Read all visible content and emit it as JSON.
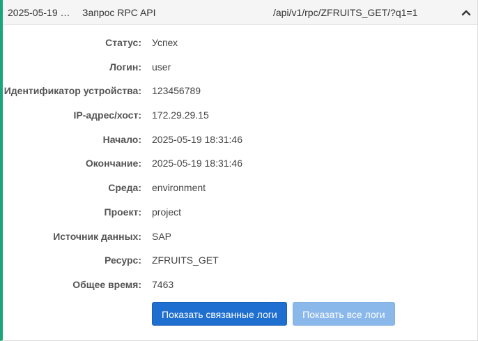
{
  "header": {
    "time": "2025-05-19 1...",
    "type": "Запрос RPC API",
    "url": "/api/v1/rpc/ZFRUITS_GET/?q1=1",
    "toggle_icon": "chevron-up-icon"
  },
  "details": [
    {
      "label": "Статус:",
      "value": "Успех"
    },
    {
      "label": "Логин:",
      "value": "user"
    },
    {
      "label": "Идентификатор устройства:",
      "value": "123456789"
    },
    {
      "label": "IP-адрес/хост:",
      "value": "172.29.29.15"
    },
    {
      "label": "Начало:",
      "value": "2025-05-19 18:31:46"
    },
    {
      "label": "Окончание:",
      "value": "2025-05-19 18:31:46"
    },
    {
      "label": "Среда:",
      "value": "environment"
    },
    {
      "label": "Проект:",
      "value": "project"
    },
    {
      "label": "Источник данных:",
      "value": "SAP"
    },
    {
      "label": "Ресурс:",
      "value": "ZFRUITS_GET"
    },
    {
      "label": "Общее время:",
      "value": "7463"
    }
  ],
  "actions": {
    "related_logs_label": "Показать связанные логи",
    "all_logs_label": "Показать все логи"
  },
  "colors": {
    "accent_border": "#1aa67a",
    "primary_button": "#1f6fd1",
    "secondary_button": "#8ab8ea"
  }
}
